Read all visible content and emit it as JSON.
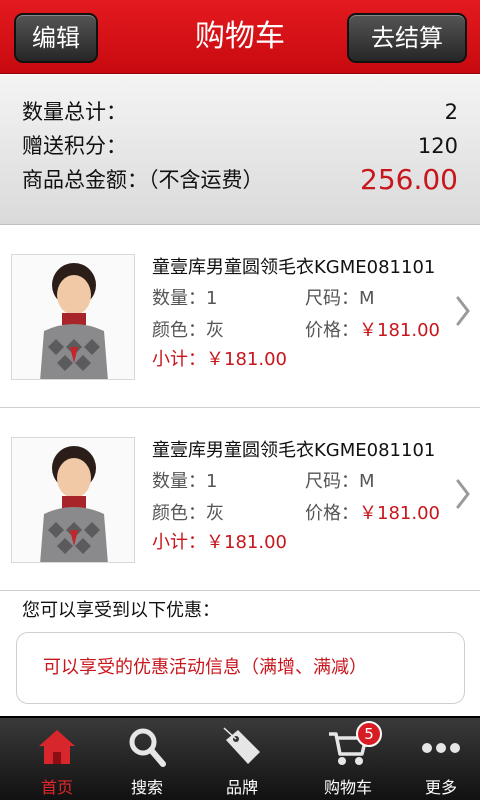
{
  "header": {
    "title": "购物车",
    "edit_label": "编辑",
    "checkout_label": "去结算"
  },
  "summary": {
    "quantity_label": "数量总计：",
    "quantity_value": "2",
    "points_label": "赠送积分：",
    "points_value": "120",
    "total_label": "商品总金额：（不含运费）",
    "total_value": "256.00"
  },
  "items": [
    {
      "name": "童壹库男童圆领毛衣KGME081101",
      "qty_label": "数量：",
      "qty": "1",
      "size_label": "尺码：",
      "size": "M",
      "color_label": "颜色：",
      "color": "灰",
      "price_label": "价格：",
      "price": "￥181.00",
      "subtotal_label": "小计：",
      "subtotal": "￥181.00"
    },
    {
      "name": "童壹库男童圆领毛衣KGME081101",
      "qty_label": "数量：",
      "qty": "1",
      "size_label": "尺码：",
      "size": "M",
      "color_label": "颜色：",
      "color": "灰",
      "price_label": "价格：",
      "price": "￥181.00",
      "subtotal_label": "小计：",
      "subtotal": "￥181.00"
    }
  ],
  "promo": {
    "title": "您可以享受到以下优惠：",
    "text": "可以享受的优惠活动信息（满增、满减）"
  },
  "tabs": [
    {
      "label": "首页",
      "icon": "home-icon",
      "active": true
    },
    {
      "label": "搜索",
      "icon": "search-icon",
      "active": false
    },
    {
      "label": "品牌",
      "icon": "tag-icon",
      "active": false
    },
    {
      "label": "购物车",
      "icon": "cart-icon",
      "active": false,
      "badge": "5"
    },
    {
      "label": "更多",
      "icon": "more-icon",
      "active": false
    }
  ],
  "colors": {
    "brand_red": "#e41a1f",
    "price_red": "#c8161d",
    "tabbar_dark": "#1f1f1f"
  }
}
